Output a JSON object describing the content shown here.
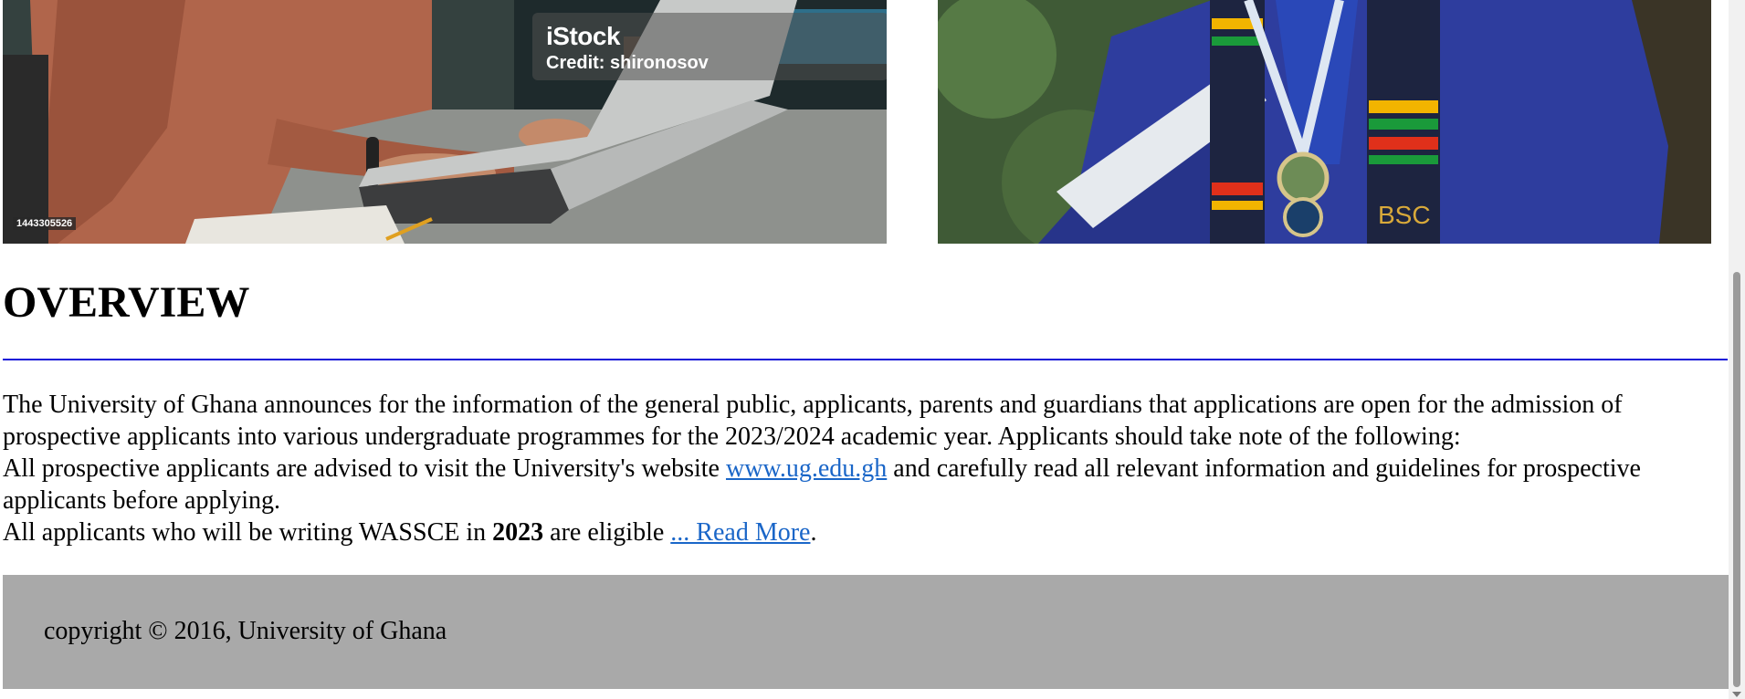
{
  "images": {
    "left": {
      "watermark_logo": "iStock",
      "credit": "Credit: shironosov",
      "stock_id": "1443305526"
    }
  },
  "overview": {
    "title": "OVERVIEW",
    "paragraph1": "The University of Ghana announces for the information of the general public, applicants, parents and guardians that applications are open for the admission of prospective applicants into various undergraduate programmes for the 2023/2024 academic year. Applicants should take note of the following:",
    "paragraph2_before": "All prospective applicants are advised to visit the University's website ",
    "website_link": "www.ug.edu.gh",
    "paragraph2_after": " and carefully read all relevant information and guidelines for prospective applicants before applying.",
    "paragraph3_before": "All applicants who will be writing WASSCE in ",
    "year_bold": "2023",
    "paragraph3_middle": " are eligible ",
    "read_more": "... Read More",
    "paragraph3_end": "."
  },
  "footer": {
    "copyright": "copyright © 2016, University of Ghana"
  },
  "colors": {
    "rule": "#1414d8",
    "link": "#1a66c8",
    "footer_bg": "#a9a9a9"
  }
}
